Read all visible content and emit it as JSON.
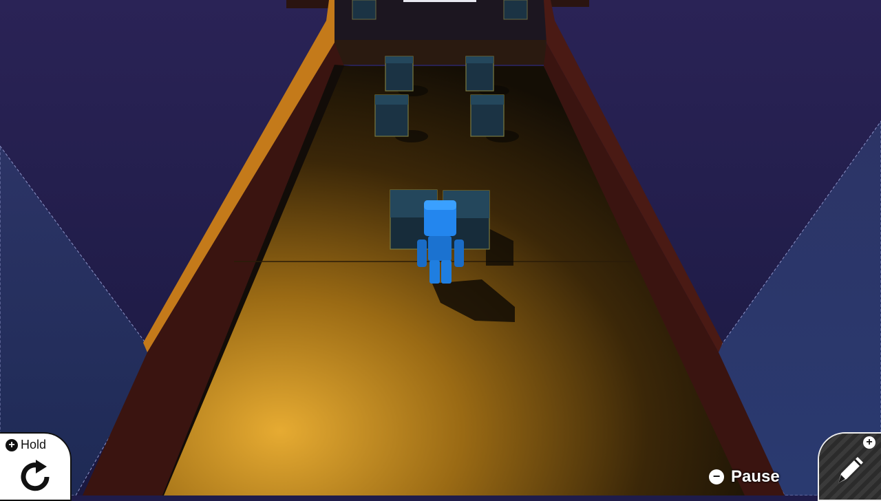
{
  "hud": {
    "hold": {
      "label": "Hold",
      "button_glyph": "+",
      "icon": "rotate-icon"
    },
    "pause": {
      "label": "Pause",
      "button_glyph": "−"
    },
    "edit": {
      "button_glyph": "+",
      "icon": "pencil-icon"
    }
  },
  "colors": {
    "sky": "#1f1c4a",
    "floor_light": "#e0a32c",
    "floor_dark": "#1a1308",
    "wall": "#3a1212",
    "block": "#1b3344",
    "robot": "#1f7ee0",
    "hud_panel": "#ffffff"
  }
}
